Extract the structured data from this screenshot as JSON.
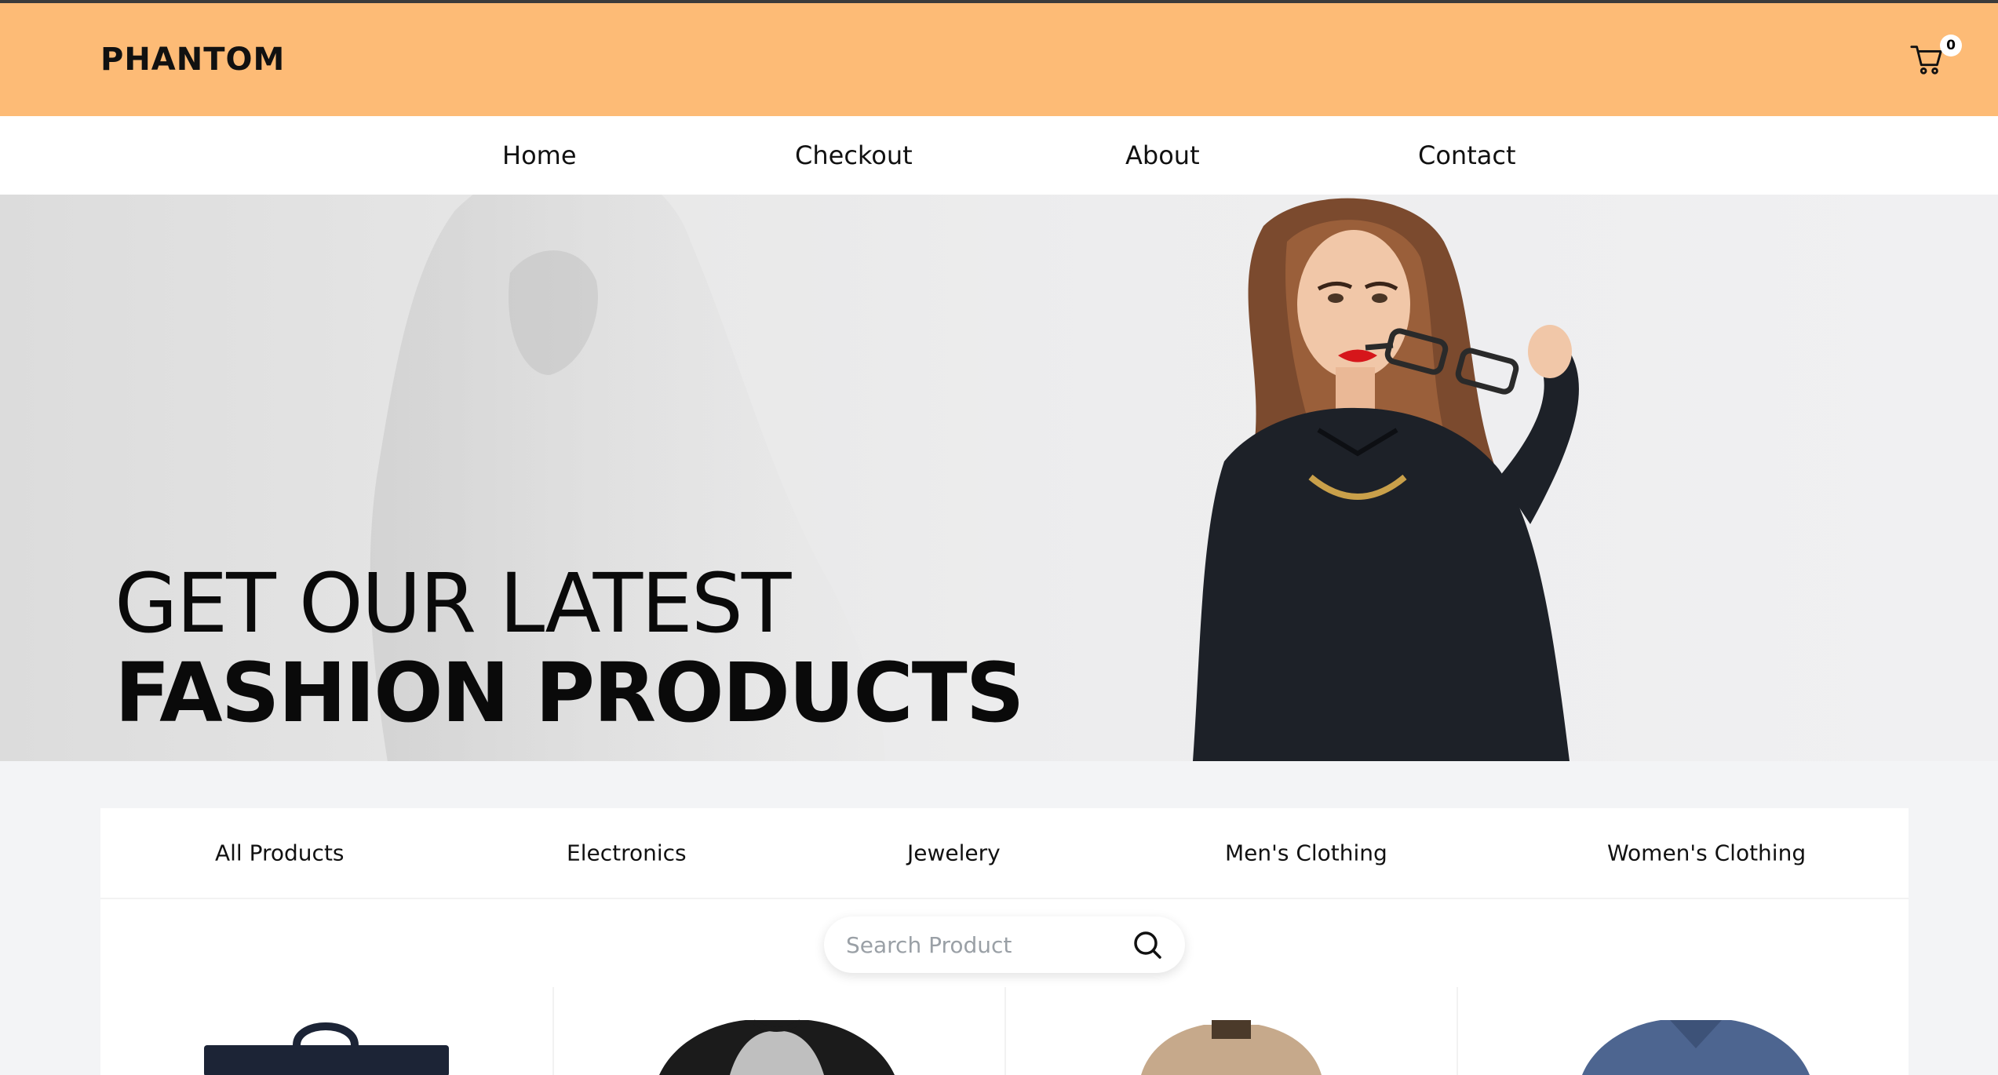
{
  "header": {
    "logo": "PHANTOM",
    "cart_count": "0",
    "background": "#fdbb76"
  },
  "nav": {
    "items": [
      "Home",
      "Checkout",
      "About",
      "Contact"
    ]
  },
  "hero": {
    "line1": "GET OUR LATEST",
    "line2": "FASHION PRODUCTS"
  },
  "categories": {
    "items": [
      "All Products",
      "Electronics",
      "Jewelery",
      "Men's Clothing",
      "Women's Clothing"
    ]
  },
  "search": {
    "placeholder": "Search Product",
    "value": ""
  },
  "products": {
    "thumbnails": [
      "bag-image",
      "raglan-tshirt-image",
      "jacket-image",
      "vneck-tshirt-image"
    ]
  }
}
